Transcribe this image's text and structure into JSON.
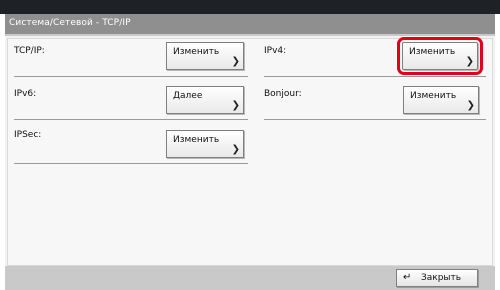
{
  "title": "Система/Сетевой - TCP/IP",
  "items": [
    {
      "label": "TCP/IP:",
      "button": "Изменить"
    },
    {
      "label": "IPv4:",
      "button": "Изменить"
    },
    {
      "label": "IPv6:",
      "button": "Далее"
    },
    {
      "label": "Bonjour:",
      "button": "Изменить"
    },
    {
      "label": "IPSec:",
      "button": "Изменить"
    }
  ],
  "footer": {
    "close_label": "Закрыть"
  },
  "icons": {
    "chevron": "chevron-right-icon",
    "enter": "enter-icon"
  },
  "colors": {
    "highlight": "#e2001a",
    "title_bar": "#8f8f8f"
  }
}
